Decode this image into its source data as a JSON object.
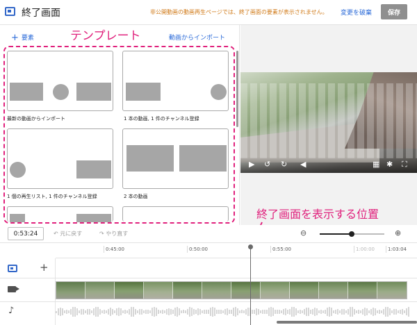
{
  "header": {
    "title": "終了画面",
    "notice": "非公開動画の動画再生ページでは、終了画面の要素が表示されません。",
    "discard_label": "変更を破棄",
    "save_label": "保存"
  },
  "left_panel": {
    "add_element_label": "要素",
    "import_label": "動画からインポート",
    "templates_annotation": "テンプレート",
    "templates": [
      {
        "label": "最新の動画からインポート"
      },
      {
        "label": "1 本の動画, 1 件のチャンネル登録"
      },
      {
        "label": "1 個の再生リスト, 1 件のチャンネル登録"
      },
      {
        "label": "2 本の動画"
      }
    ]
  },
  "annotation": {
    "end_screen_position": "終了画面を表示する位置"
  },
  "player": {
    "controls": [
      "play-icon",
      "rewind-icon",
      "forward-icon",
      "volume-icon",
      "grid-icon",
      "settings-icon",
      "fullscreen-icon"
    ]
  },
  "timeline_toolbar": {
    "current_time": "0:53:24",
    "undo_label": "元に戻す",
    "redo_label": "やり直す",
    "zoom_level": 0.5
  },
  "ruler": {
    "ticks": [
      "0:45:00",
      "0:50:00",
      "0:55:00",
      "1:00:00",
      "1:03:04"
    ]
  },
  "colors": {
    "accent": "#3166c8",
    "annotation": "#e0207c",
    "notice": "#d07a18",
    "link": "#2a6ad8"
  }
}
